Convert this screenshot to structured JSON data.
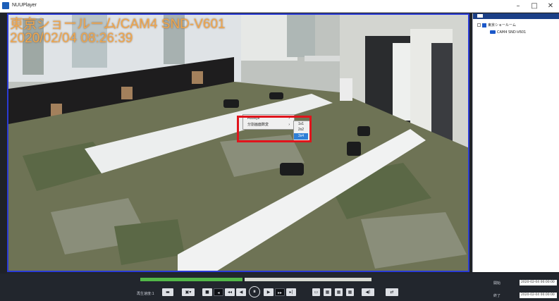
{
  "window": {
    "title": "NUUPlayer",
    "minimize_glyph": "–",
    "maximize_glyph": "□",
    "close_glyph": "✕"
  },
  "video": {
    "osd_camera": "東京ショールーム/CAM4 SND-V601",
    "osd_datetime": "2020/02/04 08:26:39"
  },
  "context_menu": {
    "items": [
      {
        "label": "Fisheye",
        "arrow": "›"
      },
      {
        "label": "分割画面数変",
        "arrow": "›"
      }
    ],
    "submenu": [
      "1x1",
      "2x2",
      "3x4"
    ],
    "selected_submenu": "3x4"
  },
  "device_tree": {
    "root": "東京ショールーム",
    "child": "CAM4 SND-V601"
  },
  "controls": {
    "speed_label": "再生速度:1",
    "progress_fraction": 0.445,
    "pause_glyph": "⏸",
    "start_label": "開始",
    "end_label": "終了",
    "start_time": "2020-02-04  00:00:00",
    "end_time": "2020-02-04  00:00:00"
  },
  "colors": {
    "osd_text": "#f0a64c",
    "video_border": "#2a3bd6",
    "highlight_box": "#e0141c",
    "progress": "#52b848",
    "tree_header": "#1b3f86"
  }
}
